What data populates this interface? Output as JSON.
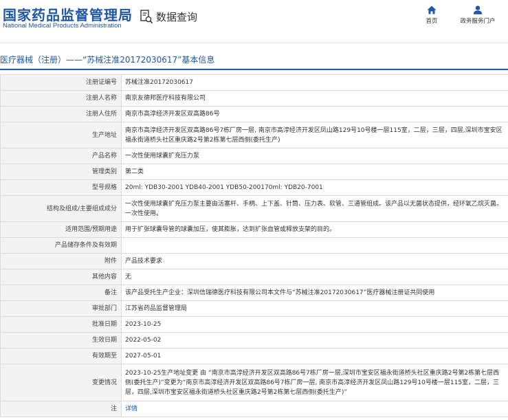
{
  "header": {
    "logo_cn": "国家药品监督管理局",
    "logo_en": "National Medical Products Administration",
    "query_label": "数据查询",
    "nav_home": "首页",
    "nav_user": "政务服务门户"
  },
  "page_title": "医疗器械（注册）——“苏械注准20172030617”基本信息",
  "rows": [
    {
      "label": "注册证编号",
      "value": "苏械注准20172030617"
    },
    {
      "label": "注册人名称",
      "value": "南京友德邦医疗科技有限公司"
    },
    {
      "label": "注册人住所",
      "value": "南京市高淳经济开发区双高路86号"
    },
    {
      "label": "生产地址",
      "value": "南京市高淳经济开发区双高路86号7栋厂房一层, 南京市高淳经济开发区凤山路129号10号楼一层115室，二层，三层，四层,深圳市宝安区福永街道桥头社区重庆路2号第2栋第七层西侧(委托生产)"
    },
    {
      "label": "产品名称",
      "value": "一次性使用球囊扩充压力泵"
    },
    {
      "label": "管理类别",
      "value": "第二类"
    },
    {
      "label": "型号规格",
      "value": "20ml: YDB30-2001 YDB40-2001 YDB50-200170ml: YDB20-7001"
    },
    {
      "label": "结构及组成/主要组成成分",
      "value": "一次性使用球囊扩充压力泵主要由活塞杆、手柄、上下盖、针筒、压力表、软管、三通管组成。该产品以无菌状态提供，经环氧乙烷灭菌。一次性使用。"
    },
    {
      "label": "适用范围/预期用途",
      "value": "用于扩张球囊导管的球囊加压，使其膨胀，达到扩张血管或释放支架的目的。"
    },
    {
      "label": "产品储存条件及有效期",
      "value": ""
    },
    {
      "label": "附件",
      "value": "产品技术要求"
    },
    {
      "label": "其他内容",
      "value": "无"
    },
    {
      "label": "备注",
      "value": "该产品受托生产企业：深圳信瑞德医疗科技有限公司本文件与“苏械注准20172030617”医疗器械注册证共同使用"
    },
    {
      "label": "审批部门",
      "value": "江苏省药品监督管理局"
    },
    {
      "label": "批准日期",
      "value": "2023-10-25"
    },
    {
      "label": "生效日期",
      "value": "2022-05-02"
    },
    {
      "label": "有效期至",
      "value": "2027-05-01"
    },
    {
      "label": "变更情况",
      "value": "2023-10-25生产地址变更 由 “南京市高淳经济开发区双高路86号7栋厂房一层,深圳市宝安区福永街道桥头社区重庆路2号第2栋第七层西侧(委托生产)”变更为“南京市高淳经济开发区双高路86号7栋厂房一层, 南京市高淳经济开发区凤山路129号10号楼一层115室，二层，三层，四层,深圳市宝安区福永街道桥头社区重庆路2号第2栋第七层西侧(委托生产)”"
    },
    {
      "label": "注",
      "value": "详情"
    }
  ],
  "colors": {
    "brand": "#1f57a4",
    "label_bg": "#f3f3f3",
    "border": "#dcdcdc"
  }
}
